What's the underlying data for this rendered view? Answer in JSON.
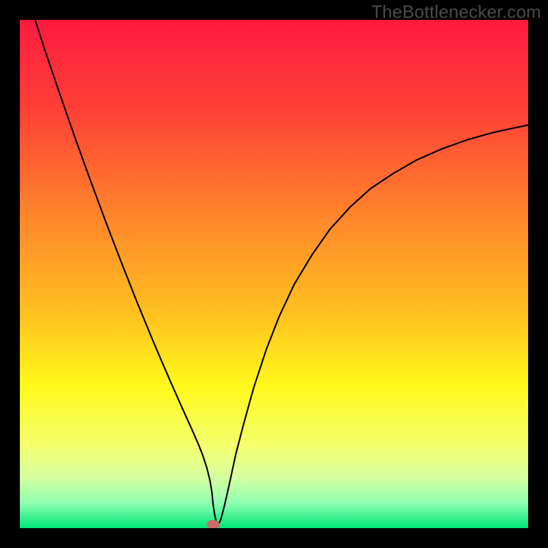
{
  "watermark": "TheBottlenecker.com",
  "chart_data": {
    "type": "line",
    "title": "",
    "xlabel": "",
    "ylabel": "",
    "xlim": [
      0,
      100
    ],
    "ylim": [
      0,
      100
    ],
    "grid": false,
    "background_gradient_stops": [
      {
        "pos": 0.0,
        "color": "#ff1a3f"
      },
      {
        "pos": 0.18,
        "color": "#ff4136"
      },
      {
        "pos": 0.4,
        "color": "#ff8a2a"
      },
      {
        "pos": 0.58,
        "color": "#ffc11f"
      },
      {
        "pos": 0.72,
        "color": "#fff91a"
      },
      {
        "pos": 0.84,
        "color": "#f3ff6e"
      },
      {
        "pos": 0.9,
        "color": "#d7ffa0"
      },
      {
        "pos": 0.95,
        "color": "#8fffb0"
      },
      {
        "pos": 1.0,
        "color": "#00e67a"
      }
    ],
    "series": [
      {
        "name": "bottleneck-curve",
        "color": "#000000",
        "width": 2.2,
        "x": [
          3.0,
          5.0,
          8.0,
          11.0,
          14.0,
          17.0,
          20.0,
          23.0,
          26.0,
          28.0,
          30.0,
          32.0,
          33.5,
          35.0,
          36.0,
          36.8,
          37.4,
          37.8,
          38.0,
          38.3,
          38.6,
          39.0,
          39.5,
          40.2,
          41.2,
          42.5,
          44.0,
          46.0,
          48.5,
          51.0,
          54.0,
          57.5,
          61.0,
          65.0,
          69.0,
          73.5,
          78.0,
          83.0,
          88.0,
          93.0,
          98.0,
          100.0
        ],
        "y": [
          100.0,
          93.8,
          85.0,
          76.4,
          68.1,
          60.0,
          52.2,
          44.6,
          37.3,
          32.6,
          28.0,
          23.5,
          20.2,
          16.8,
          14.3,
          11.8,
          9.4,
          7.0,
          4.8,
          2.8,
          1.4,
          0.7,
          1.6,
          4.2,
          8.6,
          14.6,
          20.4,
          27.6,
          35.2,
          41.6,
          48.0,
          53.8,
          58.8,
          63.2,
          66.8,
          69.8,
          72.4,
          74.6,
          76.4,
          77.8,
          78.9,
          79.3
        ]
      }
    ],
    "marker": {
      "name": "optimal-point",
      "x": 38.0,
      "y": 0.7,
      "rx": 1.3,
      "ry": 0.9,
      "color": "#d06a6a"
    }
  }
}
